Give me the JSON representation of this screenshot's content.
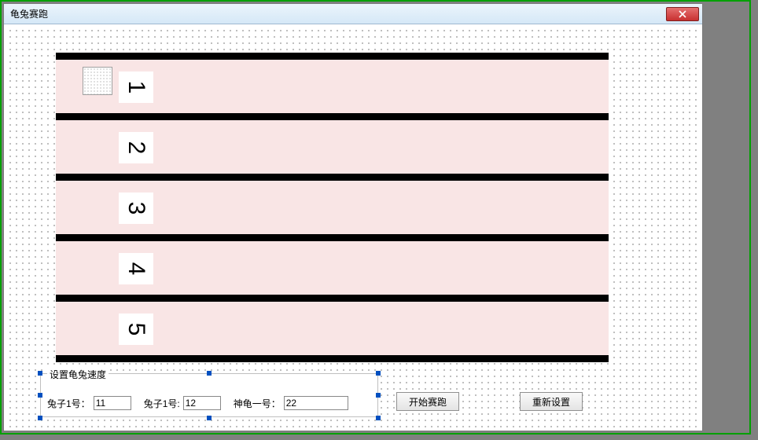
{
  "window": {
    "title": "龟兔赛跑"
  },
  "lanes": {
    "l1": "1",
    "l2": "2",
    "l3": "3",
    "l4": "4",
    "l5": "5"
  },
  "settings": {
    "legend": "设置龟兔速度",
    "rabbit1_label": "兔子1号：",
    "rabbit1_value": "11",
    "rabbit2_label": "兔子1号:",
    "rabbit2_value": "12",
    "turtle1_label": "神龟一号：",
    "turtle1_value": "22"
  },
  "buttons": {
    "start": "开始赛跑",
    "reset": "重新设置"
  }
}
